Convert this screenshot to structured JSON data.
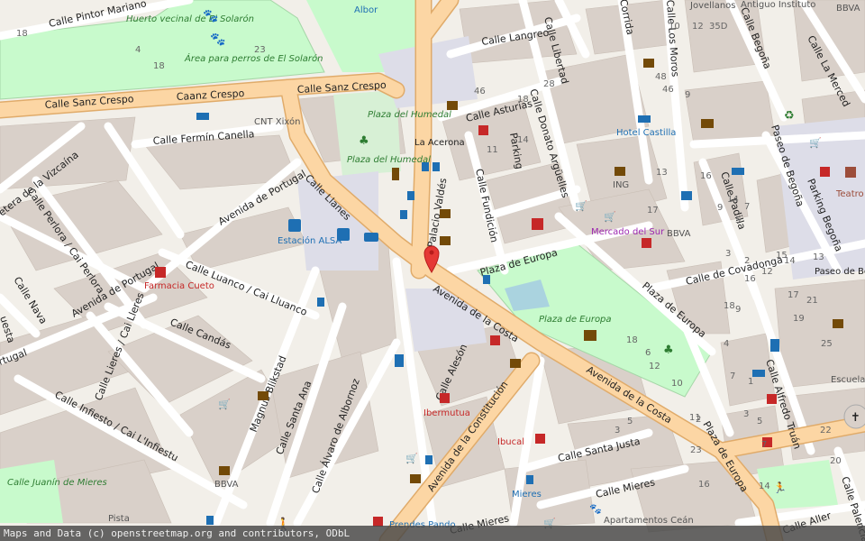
{
  "map": {
    "colors": {
      "background": "#f2efe9",
      "building": "#d9d0c9",
      "primary_road": "#fcd6a4",
      "road": "#ffffff",
      "park": "#c8facc",
      "pedestrian": "#dddde8",
      "marker": "#e53935"
    },
    "streets": {
      "pintor_mariano": "Calle Pintor Mariano",
      "sanz_crespo_w": "Calle Sanz Crespo",
      "sanz_crespo_mid": "Caanz Crespo",
      "sanz_crespo_e": "Calle Sanz Crespo",
      "langreo": "Calle Langreo",
      "libertad": "Calle Libertad",
      "corrida": "Corrida",
      "los_moros": "Calle Los Moros",
      "begona": "Calle Begoña",
      "la_merced": "Calle La Merced",
      "asturias": "Calle Asturias",
      "donato": "Calle Donato Argüelles",
      "fermin": "Calle Fermín Canella",
      "vizcaina": "etera de la Vizcaína",
      "perlora": "Calle Perlora / Cai Perlora",
      "avenida_portugal_n": "Avenida de Portugal",
      "avenida_portugal_s": "Avenida de Portugal",
      "calle_llanes": "Calle Llanes",
      "palacio_valdes": "Palacio Valdés",
      "fundicion": "Calle Fundición",
      "parking": "Parking",
      "plaza_europa_top": "Plaza de Europa",
      "plaza_europa_diag": "Plaza de Europa",
      "plaza_europa_s": "Plaza de Europa",
      "covadonga": "Calle de Covadonga",
      "padilla": "Calle Padilla",
      "paseo_begona_street": "Paseo de Begoña",
      "parking_begona": "Parking Begoña",
      "nava": "Calle Nava",
      "luanco": "Calle Luanco / Cai Lluanco",
      "candas": "Calle Candás",
      "lieres": "Calle Lieres / Cai Lleres",
      "avenida_costa": "Avenida de la Costa",
      "avenida_costa_e": "Avenida de la Costa",
      "infiesto": "Calle Infiesto / Cai L'Infiestu",
      "magnus": "Magnus Blikstad",
      "santa_ana": "Calle Santa Ana",
      "alvaro": "Calle Álvaro de Albornoz",
      "aleson": "Calle Alesón",
      "constitucion": "Avenida de la Constitución",
      "santa_justa": "Calle Santa Justa",
      "mieres_e": "Calle Mieres",
      "mieres_s": "Calle Mieres",
      "alfredo": "Calle Alfredo Truán",
      "aller": "Calle Aller",
      "palencia": "Calle Palencia",
      "ortugal": "rtugal",
      "uesta": "uesta"
    },
    "pois": {
      "albor": "Albor",
      "huerto": "Huerto vecinal de El Solarón",
      "area_perros": "Área para perros de El Solarón",
      "jovellanos": "Jovellanos",
      "antiguo_instituto": "Antiguo Instituto",
      "bbva_top": "BBVA",
      "cnt": "CNT Xixón",
      "plaza_humedal_inner": "Plaza del Humedal",
      "plaza_humedal": "Plaza del Humedal",
      "la_acerona": "La Acerona",
      "hotel_castilla": "Hotel Castilla",
      "ing": "ING",
      "mercado_sur": "Mercado del Sur",
      "bbva_mid": "BBVA",
      "teatro_jovellanos": "Teatro Jovellanos",
      "paseo_begona": "Paseo de Begoña",
      "estacion_alsa": "Estación ALSA",
      "farmacia_cueto": "Farmacia Cueto",
      "plaza_europa_park": "Plaza de Europa",
      "escuela": "Escuela de Hostelería",
      "ibermutua": "Ibermutua",
      "ibucal": "Ibucal",
      "mieres_poi": "Mieres",
      "apartamentos": "Apartamentos Ceán",
      "bbva_bottom": "BBVA",
      "pista": "Pista",
      "calle_juanin": "Calle Juanín de Mieres",
      "prendes_pando": "Prendes Pando"
    },
    "numbers": [
      "18",
      "4",
      "18",
      "23",
      "10",
      "12",
      "35D",
      "46",
      "9",
      "48",
      "46",
      "18",
      "28",
      "14",
      "11",
      "13",
      "16",
      "14",
      "17",
      "9",
      "7",
      "5",
      "3",
      "2",
      "12",
      "14",
      "16",
      "18",
      "9",
      "4",
      "7",
      "1",
      "3",
      "5",
      "7",
      "13",
      "15",
      "17",
      "19",
      "21",
      "25",
      "22",
      "20",
      "14",
      "16",
      "10",
      "12",
      "6",
      "18",
      "23",
      "2",
      "11",
      "5",
      "3"
    ],
    "attribution": "Maps and Data (c) openstreetmap.org and contributors, ODbL"
  }
}
